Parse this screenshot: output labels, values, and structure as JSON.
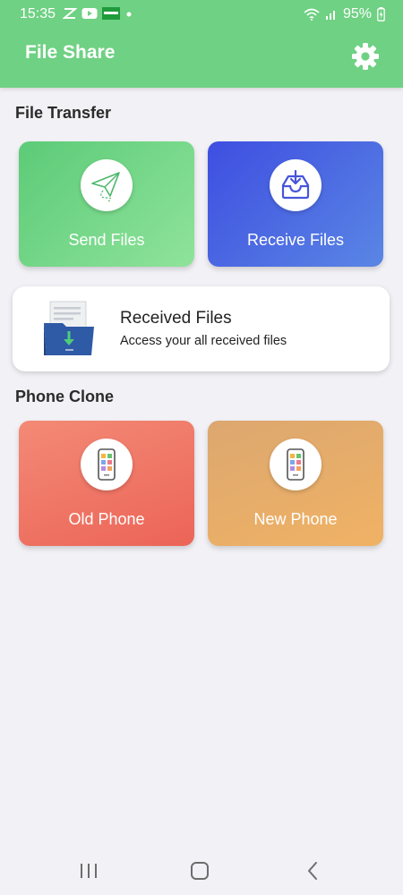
{
  "status_bar": {
    "time": "15:35",
    "battery": "95%",
    "left_icons": [
      "capcut-icon",
      "youtube-icon",
      "news-icon",
      "dot-icon"
    ],
    "right_icons": [
      "wifi-icon",
      "signal-icon",
      "battery-icon"
    ]
  },
  "app_bar": {
    "title": "File Share",
    "settings_icon": "gear-icon"
  },
  "file_transfer": {
    "section_title": "File Transfer",
    "send": {
      "label": "Send Files",
      "icon": "paper-plane-icon"
    },
    "receive": {
      "label": "Receive Files",
      "icon": "inbox-download-icon"
    }
  },
  "received_files": {
    "title": "Received Files",
    "subtitle": "Access your all received files",
    "icon": "folder-download-icon"
  },
  "phone_clone": {
    "section_title": "Phone Clone",
    "old": {
      "label": "Old Phone",
      "icon": "smartphone-icon"
    },
    "new": {
      "label": "New Phone",
      "icon": "smartphone-icon"
    }
  },
  "nav_bar": {
    "items": [
      "recent-apps-icon",
      "home-icon",
      "back-icon"
    ]
  },
  "colors": {
    "header": "#6fd183",
    "send_card": "#5ccb78",
    "receive_card": "#3e4ee1",
    "old_phone_card": "#ec6457",
    "new_phone_card": "#f0b264",
    "background": "#f2f1f6"
  }
}
